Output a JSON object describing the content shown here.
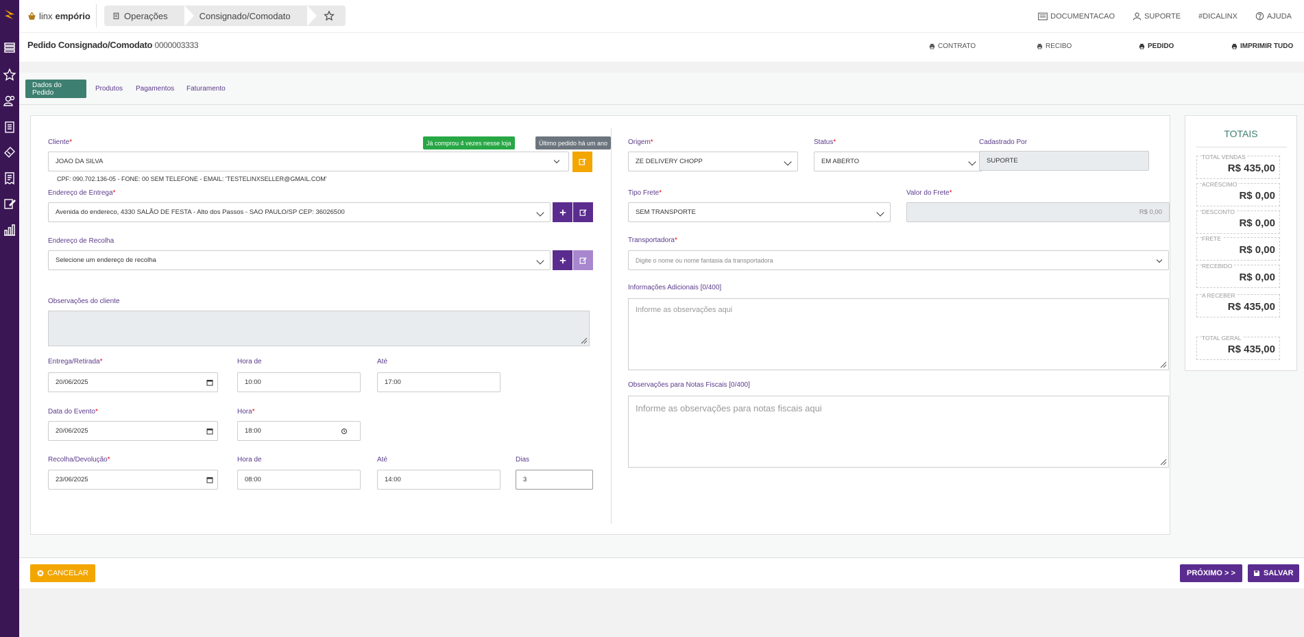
{
  "app": {
    "brand_light": "linx",
    "brand_bold": "empório"
  },
  "breadcrumb": [
    "Operações",
    "Consignado/Comodato"
  ],
  "topnav": {
    "documentacao": "DOCUMENTACAO",
    "suporte": "SUPORTE",
    "dica": "#DICALINX",
    "ajuda": "AJUDA"
  },
  "page": {
    "title": "Pedido Consignado/Comodato",
    "number": "0000003333"
  },
  "header_actions": {
    "contrato": "CONTRATO",
    "recibo": "RECIBO",
    "pedido": "PEDIDO",
    "imprimir": "IMPRIMIR TUDO"
  },
  "tabs": [
    "Dados do Pedido",
    "Produtos",
    "Pagamentos",
    "Faturamento"
  ],
  "badges": {
    "compras": "Já comprou 4 vezes nesse loja",
    "ultimo": "Último pedido há um ano"
  },
  "form": {
    "cliente_label": "Cliente",
    "cliente_value": "JOAO DA SILVA",
    "cliente_info": "CPF: 090.702.136-05 - FONE: 00 SEM TELEFONE - EMAIL: 'TESTELINXSELLER@GMAIL.COM'",
    "entrega_label": "Endereço de Entrega",
    "entrega_value": "Avenida do endereco, 4330 SALÃO DE FESTA - Alto dos Passos - SAO PAULO/SP CEP: 36026500",
    "recolha_label": "Endereço de Recolha",
    "recolha_value": "Selecione um endereço de recolha",
    "obs_cliente_label": "Observações do cliente",
    "entrega_retirada_label": "Entrega/Retirada",
    "entrega_retirada_value": "20/06/2025",
    "hora_de_label": "Hora de",
    "hora_de_value": "10:00",
    "ate_label": "Até",
    "ate_value": "17:00",
    "data_evento_label": "Data do Evento",
    "data_evento_value": "20/06/2025",
    "hora_label": "Hora",
    "hora_value": "18:00",
    "recolha_dev_label": "Recolha/Devolução",
    "recolha_dev_value": "23/06/2025",
    "hora_de2_label": "Hora de",
    "hora_de2_value": "08:00",
    "ate2_label": "Até",
    "ate2_value": "14:00",
    "dias_label": "Dias",
    "dias_value": "3",
    "origem_label": "Origem",
    "origem_value": "ZE DELIVERY CHOPP",
    "status_label": "Status",
    "status_value": "EM ABERTO",
    "cadastrado_label": "Cadastrado Por",
    "cadastrado_value": "SUPORTE",
    "tipo_frete_label": "Tipo Frete",
    "tipo_frete_value": "SEM TRANSPORTE",
    "valor_frete_label": "Valor do Frete",
    "valor_frete_value": "R$ 0,00",
    "transportadora_label": "Transportadora",
    "transportadora_placeholder": "Digite o nome ou nome fantasia da transportadora",
    "info_adicionais_label": "Informações Adicionais [0/400]",
    "info_adicionais_placeholder": "Informe as observações aqui",
    "obs_notas_label": "Observações para Notas Fiscais [0/400]",
    "obs_notas_placeholder": "Informe as observações para notas fiscais aqui"
  },
  "totals": {
    "title": "TOTAIS",
    "items": [
      {
        "label": "TOTAL VENDAS",
        "value": "R$ 435,00"
      },
      {
        "label": "ACRÉSCIMO",
        "value": "R$ 0,00"
      },
      {
        "label": "DESCONTO",
        "value": "R$ 0,00"
      },
      {
        "label": "FRETE",
        "value": "R$ 0,00"
      },
      {
        "label": "RECEBIDO",
        "value": "R$ 0,00"
      },
      {
        "label": "A RECEBER",
        "value": "R$ 435,00"
      },
      {
        "label": "TOTAL GERAL",
        "value": "R$ 435,00"
      }
    ]
  },
  "footer": {
    "cancelar": "CANCELAR",
    "proximo": "PRÓXIMO > >",
    "salvar": "SALVAR"
  },
  "colors": {
    "sidebar": "#3b1654",
    "accent_purple": "#5b2c8f",
    "tab_active": "#3d7f70",
    "orange": "#f3a600",
    "green_badge": "#28a745",
    "grey_badge": "#6c757d"
  }
}
